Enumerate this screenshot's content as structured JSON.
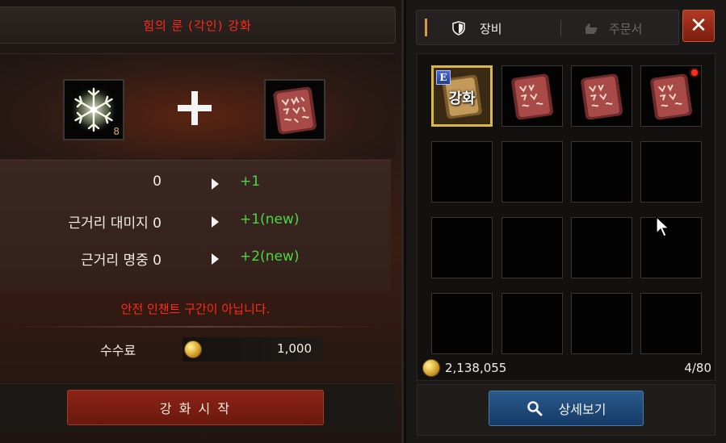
{
  "enhance": {
    "title": "힘의 룬 (각인) 강화",
    "material_count": "8",
    "stats": [
      {
        "label": "",
        "current": "0",
        "next": "+1"
      },
      {
        "label": "근거리 대미지",
        "current": "0",
        "next": "+1(new)"
      },
      {
        "label": "근거리 명중",
        "current": "0",
        "next": "+2(new)"
      }
    ],
    "warning": "안전 인챈트 구간이 아닙니다.",
    "fee_label": "수수료",
    "fee_value": "1,000",
    "start_button": "강 화 시 작"
  },
  "inventory": {
    "tabs": {
      "active": "장비",
      "inactive": "주문서"
    },
    "close_label": "✕",
    "equipped_badge": "E",
    "enhance_tag": "강화",
    "gold": "2,138,055",
    "count": "4/80",
    "detail_button": "상세보기"
  },
  "colors": {
    "title_red": "#ff2a1a",
    "stat_green": "#4ed640",
    "gold": "#e2b23a"
  },
  "icons": [
    "snowflake-icon",
    "rune-tablet-icon",
    "plus-icon",
    "play-arrow-icon",
    "coin-icon",
    "shield-icon",
    "scroll-hand-icon",
    "close-icon",
    "search-icon",
    "cursor-icon"
  ]
}
